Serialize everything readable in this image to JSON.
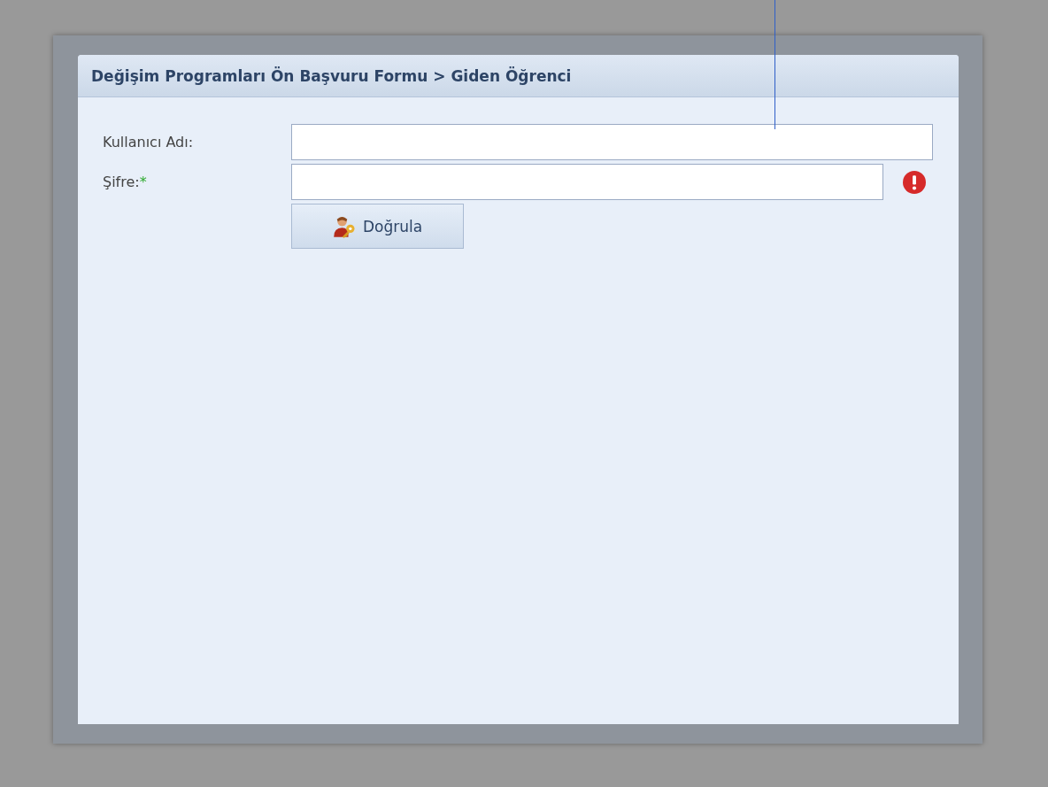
{
  "panel": {
    "title": "Değişim Programları Ön Başvuru Formu > Giden Öğrenci"
  },
  "fields": [
    {
      "label": "Kullanıcı Adı:",
      "required": false,
      "error": false
    },
    {
      "label": "Şifre:",
      "required": true,
      "error": true
    }
  ],
  "required_mark": "*",
  "button": {
    "label": "Doğrula"
  }
}
